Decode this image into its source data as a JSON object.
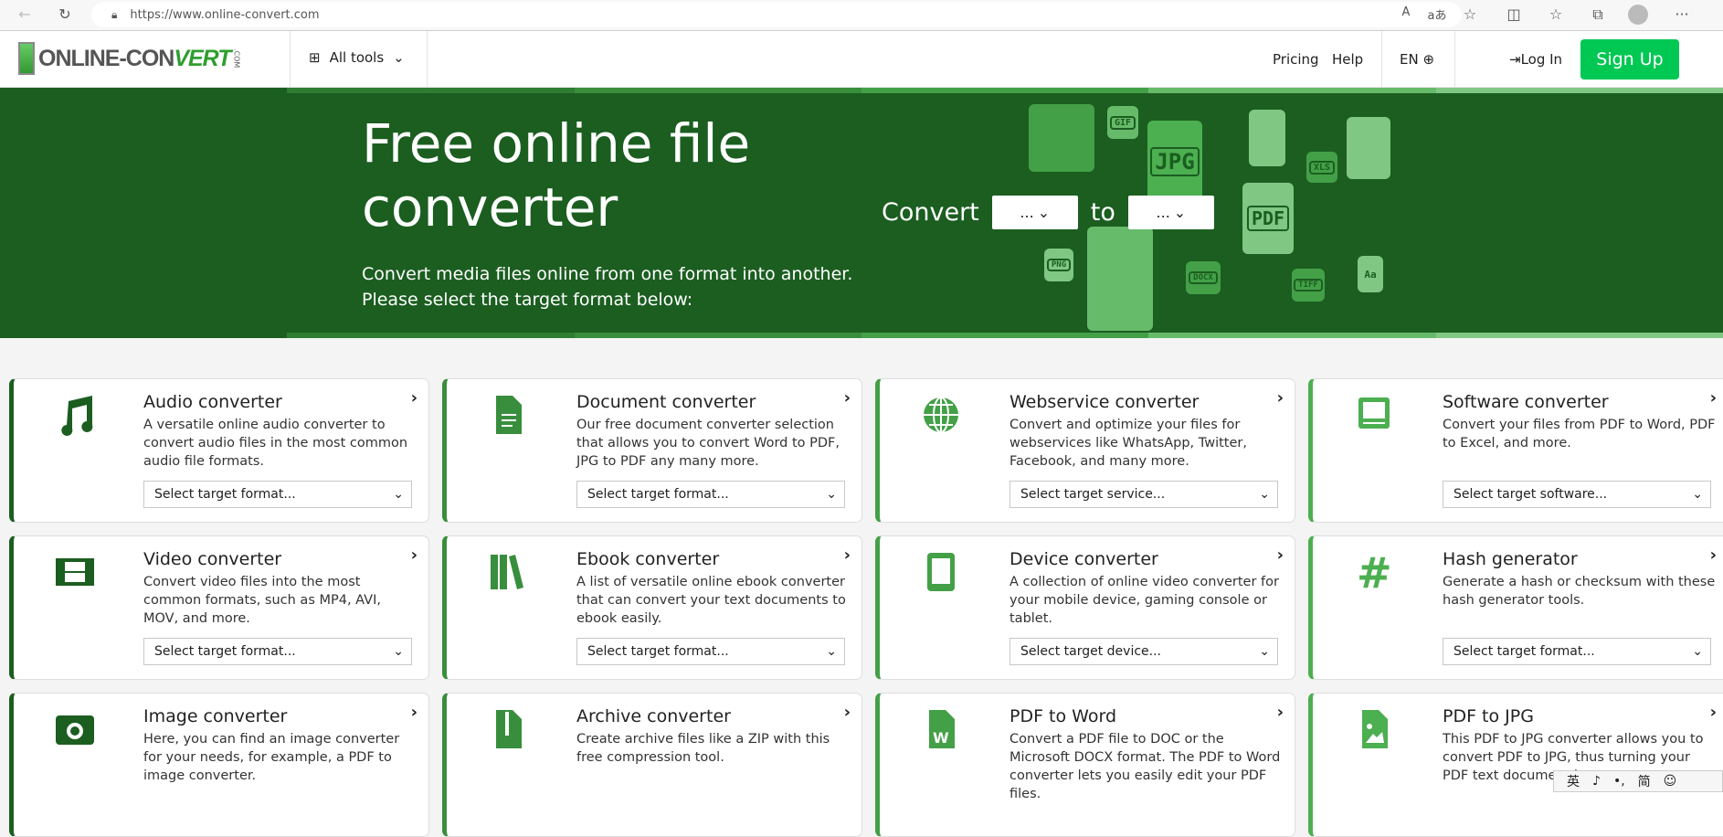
{
  "browser": {
    "url": "https://www.online-convert.com",
    "icons": [
      "back-icon",
      "refresh-icon",
      "lock-icon",
      "read-aloud-icon",
      "translate-icon",
      "favorite-add-icon",
      "split-screen-icon",
      "favorites-icon",
      "collections-icon",
      "profile-icon",
      "more-icon"
    ],
    "more": "···"
  },
  "header": {
    "logo_text": "ONLINE-CONVERT.COM",
    "all_tools": "All tools",
    "pricing": "Pricing",
    "help": "Help",
    "lang": "EN",
    "login": "Log In",
    "signup": "Sign Up"
  },
  "hero": {
    "title": "Free online file converter",
    "subtitle": "Convert media files online from one format into another. Please select the target format below:",
    "convert_label": "Convert",
    "to_label": "to",
    "from_value": "...",
    "to_value": "...",
    "file_labels": [
      "GIF",
      "JPG",
      "XLS",
      "PDF",
      "PNG",
      "DOCX",
      "TIFF",
      "Aa"
    ]
  },
  "colors": {
    "hero_bg": "#1b5e20",
    "signup": "#00c853",
    "accents": [
      "#1b5e20",
      "#388e3c",
      "#43a047",
      "#4caf50"
    ]
  },
  "cards": [
    {
      "title": "Audio converter",
      "desc": "A versatile online audio converter to convert audio files in the most common audio file formats.",
      "select": "Select target format...",
      "icon": "music-note-icon"
    },
    {
      "title": "Document converter",
      "desc": "Our free document converter selection that allows you to convert Word to PDF, JPG to PDF any many more.",
      "select": "Select target format...",
      "icon": "document-icon"
    },
    {
      "title": "Webservice converter",
      "desc": "Convert and optimize your files for webservices like WhatsApp, Twitter, Facebook, and many more.",
      "select": "Select target service...",
      "icon": "globe-icon"
    },
    {
      "title": "Software converter",
      "desc": "Convert your files from PDF to Word, PDF to Excel, and more.",
      "select": "Select target software...",
      "icon": "computer-icon"
    },
    {
      "title": "Video converter",
      "desc": "Convert video files into the most common formats, such as MP4, AVI, MOV, and more.",
      "select": "Select target format...",
      "icon": "film-icon"
    },
    {
      "title": "Ebook converter",
      "desc": "A list of versatile online ebook converter that can convert your text documents to ebook easily.",
      "select": "Select target format...",
      "icon": "books-icon"
    },
    {
      "title": "Device converter",
      "desc": "A collection of online video converter for your mobile device, gaming console or tablet.",
      "select": "Select target device...",
      "icon": "tablet-icon"
    },
    {
      "title": "Hash generator",
      "desc": "Generate a hash or checksum with these hash generator tools.",
      "select": "Select target format...",
      "icon": "hash-icon"
    },
    {
      "title": "Image converter",
      "desc": "Here, you can find an image converter for your needs, for example, a PDF to image converter.",
      "select": "",
      "icon": "camera-icon"
    },
    {
      "title": "Archive converter",
      "desc": "Create archive files like a ZIP with this free compression tool.",
      "select": "",
      "icon": "zip-file-icon"
    },
    {
      "title": "PDF to Word",
      "desc": "Convert a PDF file to DOC or the Microsoft DOCX format. The PDF to Word converter lets you easily edit your PDF files.",
      "select": "",
      "icon": "word-file-icon"
    },
    {
      "title": "PDF to JPG",
      "desc": "This PDF to JPG converter allows you to convert PDF to JPG, thus turning your PDF text document into",
      "select": "",
      "icon": "image-file-icon"
    }
  ],
  "ime": {
    "items": [
      "英",
      "♪",
      "•,",
      "简",
      "☺"
    ]
  }
}
